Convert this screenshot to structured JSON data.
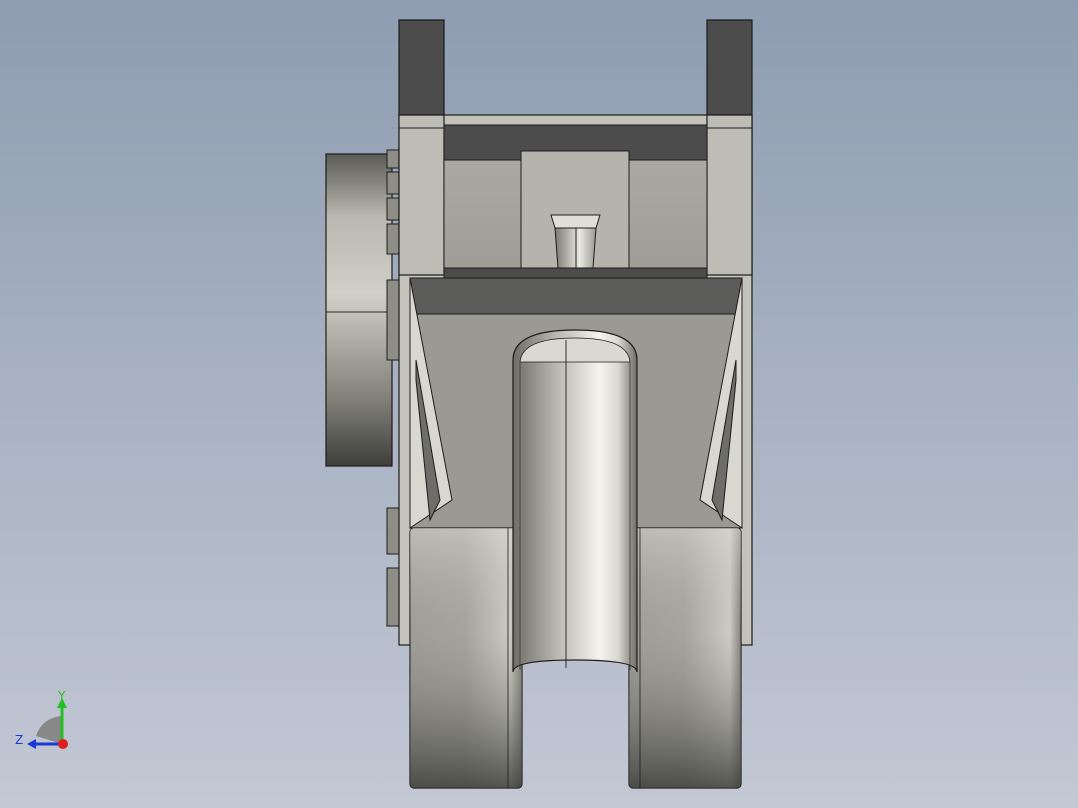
{
  "viewport": {
    "background_top": "#8e9db1",
    "background_bottom": "#c3c8d4"
  },
  "model": {
    "shade_dark": "#4a4a4a",
    "shade_mid": "#8a8a84",
    "shade_light": "#c9c9c1",
    "shade_highlight": "#f2f2ec",
    "edge_color": "#1c1c1c"
  },
  "triad": {
    "y_label": "Y",
    "z_label": "Z",
    "y_color": "#22c022",
    "z_color": "#1a3ad8",
    "x_color": "#e02020"
  }
}
